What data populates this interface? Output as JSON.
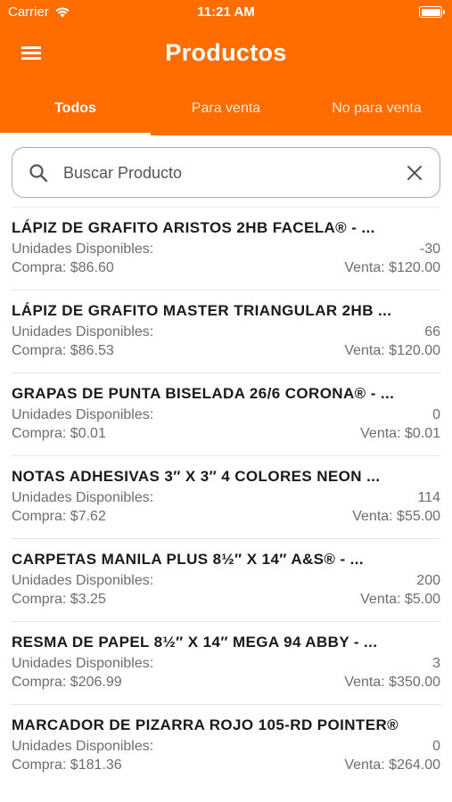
{
  "status_bar": {
    "carrier": "Carrier",
    "time": "11:21 AM"
  },
  "header": {
    "title": "Productos",
    "accent_color": "#ff6d00"
  },
  "tabs": [
    {
      "label": "Todos",
      "active": true
    },
    {
      "label": "Para venta",
      "active": false
    },
    {
      "label": "No para venta",
      "active": false
    }
  ],
  "search": {
    "placeholder": "Buscar Producto",
    "value": ""
  },
  "products": [
    {
      "name": "LÁPIZ DE GRAFITO ARISTOS 2HB FACELA® - ...",
      "units_label": "Unidades Disponibles:",
      "units": "-30",
      "compra": "Compra: $86.60",
      "venta": "Venta: $120.00"
    },
    {
      "name": "LÁPIZ DE GRAFITO MASTER TRIANGULAR 2HB ...",
      "units_label": "Unidades Disponibles:",
      "units": "66",
      "compra": "Compra: $86.53",
      "venta": "Venta: $120.00"
    },
    {
      "name": "GRAPAS DE PUNTA BISELADA 26/6 CORONA® - ...",
      "units_label": "Unidades Disponibles:",
      "units": "0",
      "compra": "Compra: $0.01",
      "venta": "Venta: $0.01"
    },
    {
      "name": "NOTAS ADHESIVAS 3″ X 3″ 4 COLORES NEON ...",
      "units_label": "Unidades Disponibles:",
      "units": "114",
      "compra": "Compra: $7.62",
      "venta": "Venta: $55.00"
    },
    {
      "name": "CARPETAS MANILA PLUS 8½″ X 14″ A&S® - ...",
      "units_label": "Unidades Disponibles:",
      "units": "200",
      "compra": "Compra: $3.25",
      "venta": "Venta: $5.00"
    },
    {
      "name": "RESMA DE PAPEL 8½″ X 14″ MEGA 94 ABBY - ...",
      "units_label": "Unidades Disponibles:",
      "units": "3",
      "compra": "Compra: $206.99",
      "venta": "Venta: $350.00"
    },
    {
      "name": "MARCADOR DE PIZARRA ROJO 105-RD POINTER®",
      "units_label": "Unidades Disponibles:",
      "units": "0",
      "compra": "Compra: $181.36",
      "venta": "Venta: $264.00"
    }
  ]
}
